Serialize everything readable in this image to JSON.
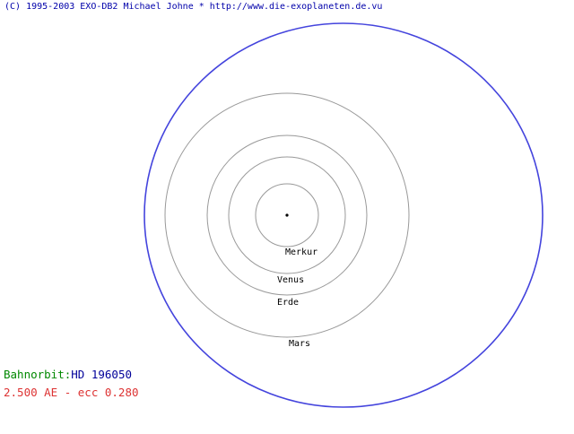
{
  "header": {
    "copyright": "(C) 1995-2003 EXO-DB2 Michael Johne * http://www.die-exoplaneten.de.vu"
  },
  "orbits": [
    {
      "name": "Merkur",
      "label": "Merkur"
    },
    {
      "name": "Venus",
      "label": "Venus"
    },
    {
      "name": "Erde",
      "label": "Erde"
    },
    {
      "name": "Mars",
      "label": "Mars"
    },
    {
      "name": "HD 196050",
      "label": ""
    }
  ],
  "info": {
    "orbit_label": "Bahnorbit:",
    "planet_name": "HD 196050",
    "orbit_params": "2.500 AE - ecc 0.280"
  },
  "colors": {
    "header_text": "#0000aa",
    "orbit_label": "#008800",
    "planet_name": "#000099",
    "orbit_params": "#dd3333",
    "planet_orbit": "#4444dd",
    "solar_orbits": "#999999",
    "labels": "#000000",
    "star": "#000000"
  }
}
